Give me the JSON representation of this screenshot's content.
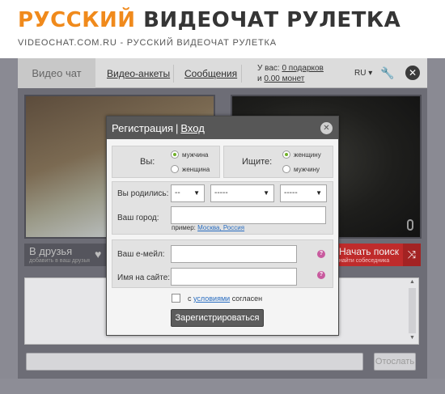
{
  "header": {
    "logo_part1": "РУССКИЙ",
    "logo_part2": "ВИДЕОЧАТ РУЛЕТКА",
    "tagline": "VIDEOCHAT.COM.RU - РУССКИЙ ВИДЕОЧАТ РУЛЕТКА"
  },
  "nav": {
    "video_chat": "Видео чат",
    "video_profiles": "Видео-анкеты",
    "messages": "Сообщения",
    "balance_prefix": "У вас:",
    "gifts": "0 подарков",
    "coins_prefix": "и",
    "coins": "0.00 монет",
    "lang": "RU",
    "icons": {
      "settings": "wrench-icon",
      "close": "close-icon",
      "lang_arrow": "chevron-down-icon"
    }
  },
  "controls": {
    "friends_label": "В друзья",
    "friends_sub": "добавить в ваш друзья",
    "search_label": "Начать поиск",
    "search_sub": "найти собеседника",
    "send_label": "Отослать",
    "icons": {
      "heart": "heart-icon",
      "shuffle": "shuffle-icon",
      "mic": "microphone-icon"
    }
  },
  "dialog": {
    "title": "Регистрация",
    "separator": "|",
    "login_link": "Вход",
    "you_label": "Вы:",
    "seek_label": "Ищите:",
    "you_options": [
      "мужчина",
      "женщина"
    ],
    "you_selected": "мужчина",
    "seek_options": [
      "женщину",
      "мужчину"
    ],
    "seek_selected": "женщину",
    "born_label": "Вы родились:",
    "day_value": "--",
    "month_value": "-----",
    "year_value": "-----",
    "city_label": "Ваш город:",
    "city_value": "",
    "example_prefix": "пример:",
    "example_city": "Москва, Россия",
    "email_label": "Ваш е-мейл:",
    "email_value": "",
    "nickname_label": "Имя на сайте:",
    "nickname_value": "",
    "help_icon": "?",
    "agree_prefix": "с",
    "agree_link": "условиями",
    "agree_suffix": "согласен",
    "agree_checked": false,
    "register_button": "Зарегистрироваться"
  },
  "colors": {
    "brand_orange": "#f08a1c",
    "search_red": "#bf2b2b",
    "link_blue": "#2a6ec1",
    "radio_green": "#6fb028"
  }
}
